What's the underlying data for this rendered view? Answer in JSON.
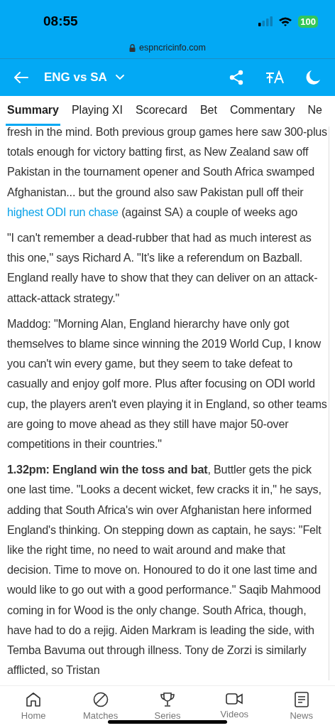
{
  "status_bar": {
    "time": "08:55",
    "battery": "100"
  },
  "address_bar": {
    "url": "espncricinfo.com"
  },
  "header": {
    "title": "ENG vs SA"
  },
  "tabs": [
    {
      "label": "Summary",
      "selected": true
    },
    {
      "label": "Playing XI",
      "selected": false
    },
    {
      "label": "Scorecard",
      "selected": false
    },
    {
      "label": "Bet",
      "selected": false
    },
    {
      "label": "Commentary",
      "selected": false
    },
    {
      "label": "Ne",
      "selected": false
    }
  ],
  "article": {
    "paragraphs": [
      {
        "parts": [
          {
            "kind": "text",
            "text": "fresh in the mind. Both previous group games here saw 300-plus totals enough for victory batting first, as New Zealand saw off Pakistan in the tournament opener and South Africa swamped Afghanistan... but the ground also saw Pakistan pull off their "
          },
          {
            "kind": "link",
            "text": "highest ODI run chase"
          },
          {
            "kind": "text",
            "text": " (against SA) a couple of weeks ago"
          }
        ]
      },
      {
        "parts": [
          {
            "kind": "text",
            "text": "\"I can't remember a dead-rubber that had as much interest as this one,\" says Richard A. \"It's like a referendum on Bazball. England really have to show that they can deliver on an attack-attack-attack strategy.\""
          }
        ]
      },
      {
        "parts": [
          {
            "kind": "text",
            "text": "Maddog: \"Morning Alan, England hierarchy have only got themselves to blame since winning the 2019 World Cup, I know you can't win every game, but they seem to take defeat to casually and enjoy golf more. Plus after focusing on ODI world cup, the players aren't even playing it in England, so other teams are going to move ahead as they still have major 50-over competitions in their countries.\""
          }
        ]
      },
      {
        "parts": [
          {
            "kind": "text",
            "text": "**1.32pm: England win the toss and bat**, Buttler gets the pick one last time. \"Looks a decent wicket, few cracks it in,\" he says, adding that South Africa's win over Afghanistan here informed England's thinking. On stepping down as captain, he says: \"Felt like the right time, no need to wait around and make that decision. Time to move on. Honoured to do it one last time and would like to go out with a good performance.\" Saqib Mahmood coming in for Wood is the only change. South Africa, though, have had to do a rejig. Aiden Markram is leading the side, with Temba Bavuma out through illness. Tony de Zorzi is similarly afflicted, so Tristan"
          }
        ]
      }
    ]
  },
  "bottom_nav": [
    {
      "label": "Home",
      "kind": "home"
    },
    {
      "label": "Matches",
      "kind": "matches"
    },
    {
      "label": "Series",
      "kind": "series"
    },
    {
      "label": "Videos",
      "kind": "videos"
    },
    {
      "label": "News",
      "kind": "news"
    }
  ]
}
